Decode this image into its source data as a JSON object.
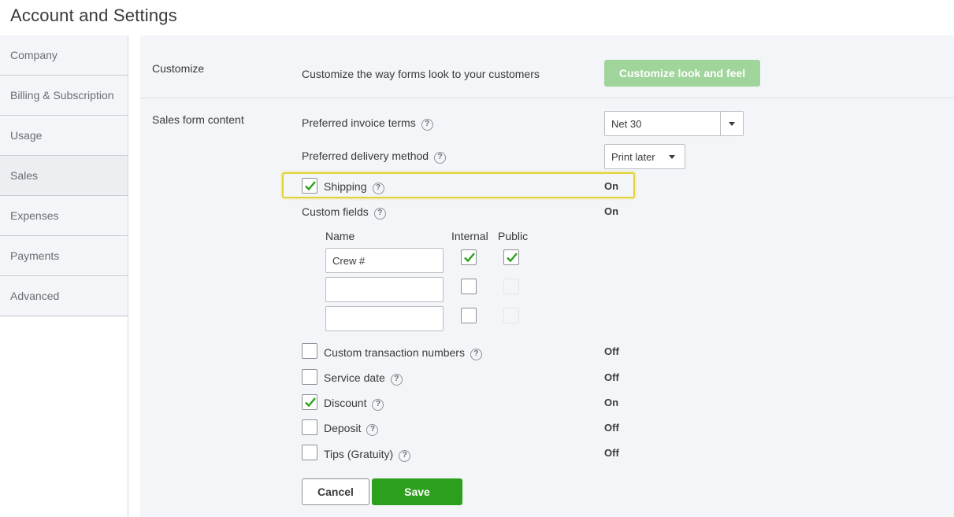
{
  "title": "Account and Settings",
  "sidebar": {
    "items": [
      {
        "label": "Company"
      },
      {
        "label": "Billing & Subscription"
      },
      {
        "label": "Usage"
      },
      {
        "label": "Sales",
        "active": true
      },
      {
        "label": "Expenses"
      },
      {
        "label": "Payments"
      },
      {
        "label": "Advanced"
      }
    ]
  },
  "customize": {
    "label": "Customize",
    "description": "Customize the way forms look to your customers",
    "button": "Customize look and feel"
  },
  "sales_form": {
    "label": "Sales form content",
    "invoice_terms": {
      "label": "Preferred invoice terms",
      "value": "Net 30"
    },
    "delivery_method": {
      "label": "Preferred delivery method",
      "value": "Print later"
    },
    "shipping": {
      "label": "Shipping",
      "status": "On",
      "checked": true
    },
    "custom_fields": {
      "label": "Custom fields",
      "status": "On",
      "headers": {
        "name": "Name",
        "internal": "Internal",
        "public": "Public"
      },
      "rows": [
        {
          "name": "Crew #",
          "internal": true,
          "public": true
        },
        {
          "name": "",
          "internal": false,
          "public": false
        },
        {
          "name": "",
          "internal": false,
          "public": false
        }
      ]
    },
    "custom_txn_numbers": {
      "label": "Custom transaction numbers",
      "status": "Off",
      "checked": false
    },
    "service_date": {
      "label": "Service date",
      "status": "Off",
      "checked": false
    },
    "discount": {
      "label": "Discount",
      "status": "On",
      "checked": true
    },
    "deposit": {
      "label": "Deposit",
      "status": "Off",
      "checked": false
    },
    "tips": {
      "label": "Tips (Gratuity)",
      "status": "Off",
      "checked": false
    }
  },
  "actions": {
    "cancel": "Cancel",
    "save": "Save"
  },
  "help_glyph": "?",
  "colors": {
    "save_green": "#2ca01c",
    "check_green": "#2ca01c",
    "highlight": "#e0d43a",
    "disabled_green": "#9fd49a"
  }
}
